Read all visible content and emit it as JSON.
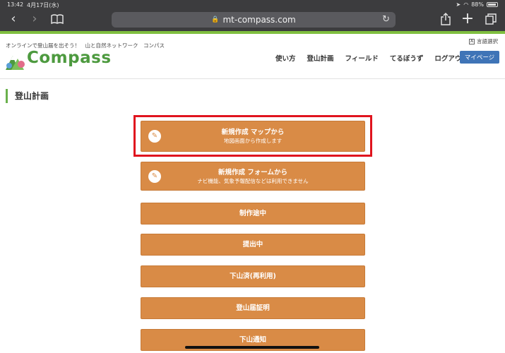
{
  "status": {
    "time": "13:42",
    "date": "4月17日(水)",
    "battery": "88%"
  },
  "browser": {
    "url": "mt-compass.com"
  },
  "site": {
    "tagline": "オンラインで登山届を出そう！　山と自然ネットワーク　コンパス",
    "language": "言語選択",
    "logo_text": "Compass",
    "nav": [
      "使い方",
      "登山計画",
      "フィールド",
      "てるぼうず",
      "ログアウト"
    ],
    "mypage": "マイページ"
  },
  "page": {
    "title": "登山計画"
  },
  "buttons": [
    {
      "title": "新規作成 マップから",
      "subtitle": "地図画面から作成します"
    },
    {
      "title": "新規作成 フォームから",
      "subtitle": "ナビ機能、気象予報配信などは利用できません"
    },
    {
      "title": "制作途中"
    },
    {
      "title": "提出中"
    },
    {
      "title": "下山済(再利用)"
    },
    {
      "title": "登山届証明"
    },
    {
      "title": "下山通知"
    }
  ],
  "colors": {
    "accent_orange": "#d98b46",
    "brand_green": "#4d9a3f",
    "mypage_blue": "#3f74b7",
    "highlight_red": "#e0141e"
  }
}
